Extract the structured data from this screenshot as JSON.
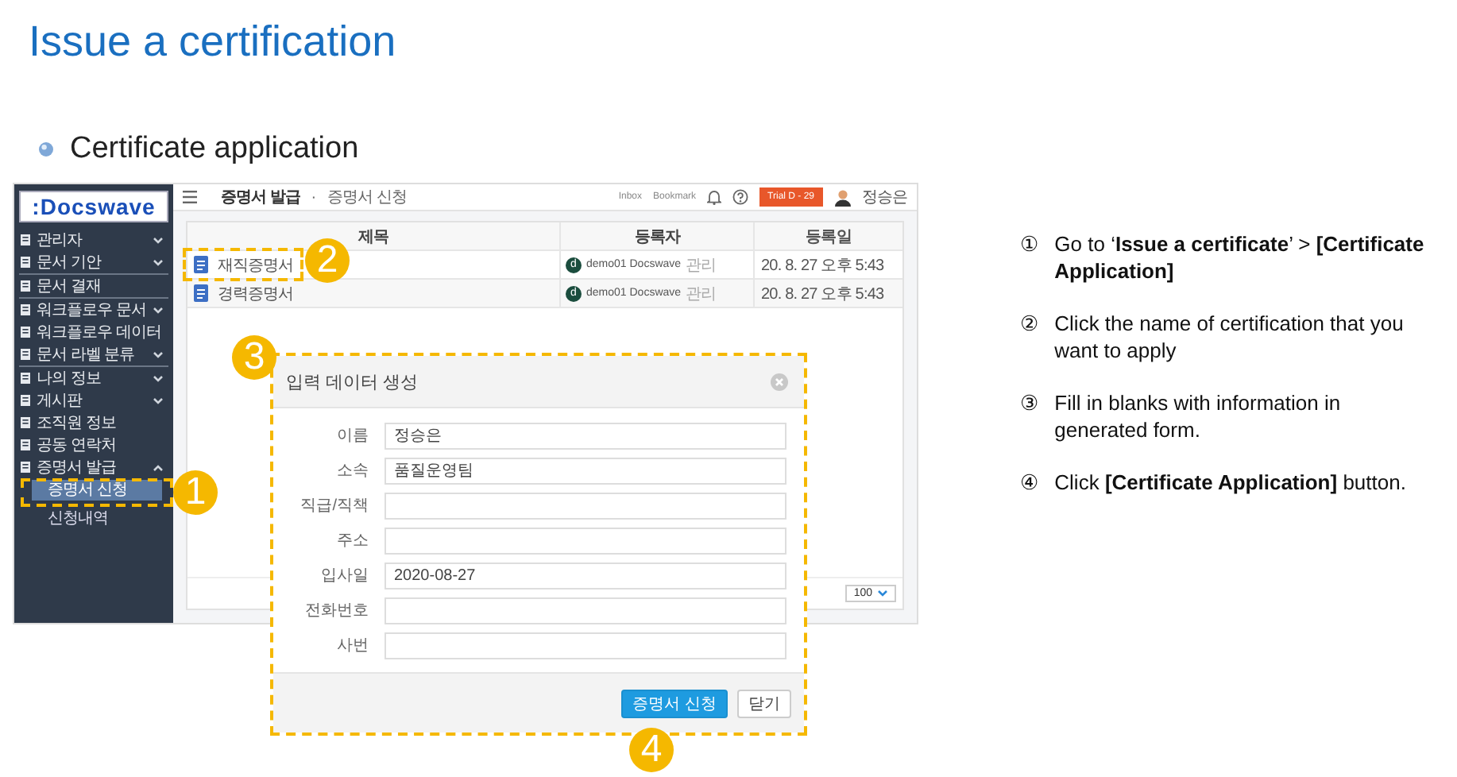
{
  "slide": {
    "title": "Issue a certification",
    "section": "Certificate application"
  },
  "app": {
    "logo": ":Docswave",
    "breadcrumb": {
      "section": "증명서 발급",
      "separator": "·",
      "page": "증명서 신청"
    },
    "top_links": [
      "Inbox",
      "Bookmark"
    ],
    "trial_badge": "Trial D - 29",
    "user_name": "정승은",
    "sidebar_sections": [
      [
        {
          "label": "관리자",
          "kind": "group",
          "expanded": false
        },
        {
          "label": "문서 기안",
          "kind": "group",
          "expanded": false
        }
      ],
      [
        {
          "label": "문서 결재",
          "kind": "link"
        }
      ],
      [
        {
          "label": "워크플로우 문서",
          "kind": "group",
          "expanded": false
        },
        {
          "label": "워크플로우 데이터",
          "kind": "link"
        },
        {
          "label": "문서 라벨 분류",
          "kind": "group",
          "expanded": false
        }
      ],
      [
        {
          "label": "나의 정보",
          "kind": "group",
          "expanded": false
        },
        {
          "label": "게시판",
          "kind": "group",
          "expanded": false
        },
        {
          "label": "조직원 정보",
          "kind": "link"
        },
        {
          "label": "공동 연락처",
          "kind": "link"
        },
        {
          "label": "증명서 발급",
          "kind": "group",
          "expanded": true,
          "children": [
            {
              "label": "증명서 신청",
              "selected": true
            },
            {
              "label": "신청내역",
              "selected": false
            }
          ]
        }
      ]
    ],
    "table": {
      "columns": [
        "제목",
        "등록자",
        "등록일"
      ],
      "rows": [
        {
          "title": "재직증명서",
          "author_initial": "d",
          "author": "demo01 Docswave",
          "role": "관리",
          "date": "20. 8. 27 오후 5:43"
        },
        {
          "title": "경력증명서",
          "author_initial": "d",
          "author": "demo01 Docswave",
          "role": "관리",
          "date": "20. 8. 27 오후 5:43"
        }
      ]
    },
    "page_size": "100"
  },
  "dialog": {
    "title": "입력 데이터 생성",
    "fields": [
      {
        "label": "이름",
        "value": "정승은"
      },
      {
        "label": "소속",
        "value": "품질운영팀"
      },
      {
        "label": "직급/직책"
      },
      {
        "label": "주소"
      },
      {
        "label": "입사일",
        "value": "2020-08-27"
      },
      {
        "label": "전화번호"
      },
      {
        "label": "사번"
      }
    ],
    "buttons": [
      {
        "label": "증명서 신청",
        "kind": "primary"
      },
      {
        "label": "닫기",
        "kind": "default"
      }
    ]
  },
  "callouts": [
    "1",
    "2",
    "3",
    "4"
  ],
  "steps": [
    {
      "number": "①",
      "text": "Go to ‘**Issue a certificate**’ > **[Certificate Application]**"
    },
    {
      "number": "②",
      "text": "Click the name of certification that you want to apply"
    },
    {
      "number": "③",
      "text": "Fill in blanks with information in generated form."
    },
    {
      "number": "④",
      "text": "Click **[Certificate Application]** button."
    }
  ]
}
